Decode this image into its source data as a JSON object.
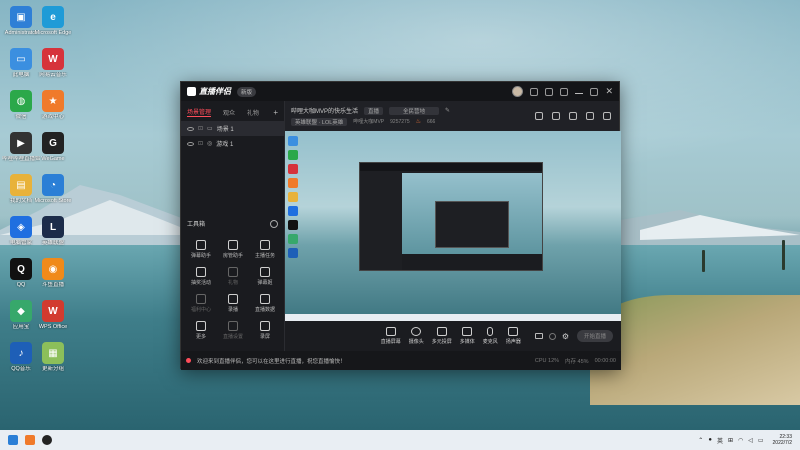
{
  "desktop": {
    "icons": [
      {
        "label": "Administrator",
        "color": "#2f7fd6",
        "glyph": "▣"
      },
      {
        "label": "Microsoft Edge",
        "color": "#1f9bd7",
        "glyph": "e"
      },
      {
        "label": "此电脑",
        "color": "#3b8fe0",
        "glyph": "▭"
      },
      {
        "label": "网易云音乐",
        "color": "#d6333b",
        "glyph": "W"
      },
      {
        "label": "微信",
        "color": "#2ba84a",
        "glyph": "◍"
      },
      {
        "label": "游戏中心",
        "color": "#f07a2a",
        "glyph": "★"
      },
      {
        "label": "哔哩哔哩直播姬",
        "color": "#333",
        "glyph": "▶"
      },
      {
        "label": "WeGame",
        "color": "#222",
        "glyph": "G"
      },
      {
        "label": "我的文档",
        "color": "#e8b23a",
        "glyph": "▤"
      },
      {
        "label": "Microsoft Store",
        "color": "#2b7fd6",
        "glyph": "◔"
      },
      {
        "label": "电脑管家",
        "color": "#1f6fe0",
        "glyph": "◈"
      },
      {
        "label": "英雄联盟",
        "color": "#1c2c4a",
        "glyph": "L"
      },
      {
        "label": "QQ",
        "color": "#111",
        "glyph": "Q"
      },
      {
        "label": "斗鱼直播",
        "color": "#f08a1a",
        "glyph": "◉"
      },
      {
        "label": "应用宝",
        "color": "#37a86b",
        "glyph": "◆"
      },
      {
        "label": "WPS Office",
        "color": "#d23b2f",
        "glyph": "W"
      },
      {
        "label": "QQ音乐",
        "color": "#1e5fb7",
        "glyph": "♪"
      },
      {
        "label": "更新分组",
        "color": "#8cbf5a",
        "glyph": "▦"
      }
    ]
  },
  "app": {
    "name": "直播伴侣",
    "version": "新版",
    "tabs": [
      "场景管理",
      "观众",
      "礼物"
    ],
    "scenes": [
      {
        "label": "场景 1",
        "icon": "display"
      },
      {
        "label": "游戏 1",
        "icon": "game"
      }
    ],
    "tools_title": "工具箱",
    "tools": [
      {
        "label": "弹幕助手",
        "dim": false
      },
      {
        "label": "房管助手",
        "dim": false
      },
      {
        "label": "主播任务",
        "dim": false
      },
      {
        "label": "抽奖活动",
        "dim": false
      },
      {
        "label": "礼物",
        "dim": true
      },
      {
        "label": "弹幕姬",
        "dim": false
      },
      {
        "label": "福利中心",
        "dim": true
      },
      {
        "label": "录播",
        "dim": false
      },
      {
        "label": "直播数据",
        "dim": false
      },
      {
        "label": "更多",
        "dim": false
      },
      {
        "label": "直播设置",
        "dim": true
      },
      {
        "label": "录屏",
        "dim": false
      }
    ],
    "room": {
      "title": "哔哩大咖MVP的快乐生活",
      "tag1": "直播",
      "tag2": "全民营地",
      "category": "英雄联盟 · LOL英雄",
      "host": "哔哩大咖MVP",
      "room_id": "9257275",
      "hot": "666"
    },
    "controls": [
      "直播屏幕",
      "摄像头",
      "多元投屏",
      "多媒体",
      "麦克风",
      "扬声器"
    ],
    "start_label": "开始直播",
    "status_msg": "欢迎来到直播伴侣，您可以在这里进行直播，祝您直播愉快！",
    "stats": [
      "CPU 12%",
      "内存 45%",
      "00:00:00"
    ]
  },
  "taskbar": {
    "tray_lang": "英",
    "time": "22:33",
    "date": "2022/7/2"
  }
}
